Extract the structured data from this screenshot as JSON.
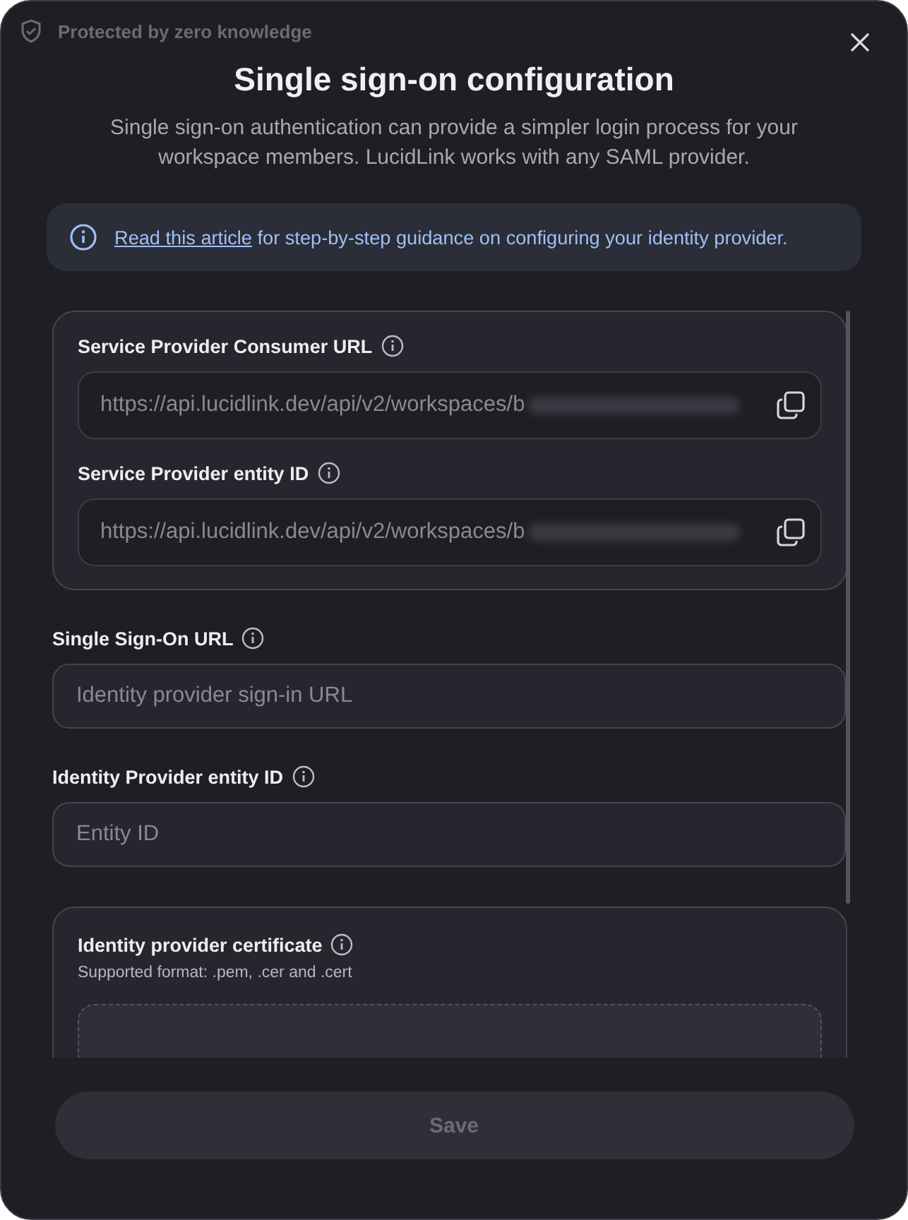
{
  "badge": "Protected by zero knowledge",
  "title": "Single sign-on configuration",
  "subtitle": "Single sign-on authentication can provide a simpler login process for your workspace members. LucidLink works with any SAML provider.",
  "notice": {
    "link": "Read this article",
    "text": " for step-by-step guidance on configuring your identity provider."
  },
  "service_provider": [
    {
      "label": "Service Provider Consumer URL",
      "value": "https://api.lucidlink.dev/api/v2/workspaces/b",
      "redacted": true
    },
    {
      "label": "Service Provider entity ID",
      "value": "https://api.lucidlink.dev/api/v2/workspaces/b",
      "redacted": true
    }
  ],
  "identity_provider": [
    {
      "label": "Single Sign-On URL",
      "placeholder": "Identity provider sign-in URL"
    },
    {
      "label": "Identity Provider entity ID",
      "placeholder": "Entity ID"
    }
  ],
  "certificate": {
    "label": "Identity provider certificate",
    "hint": "Supported format: .pem, .cer and .cert"
  },
  "save": {
    "label": "Save",
    "disabled": true
  }
}
